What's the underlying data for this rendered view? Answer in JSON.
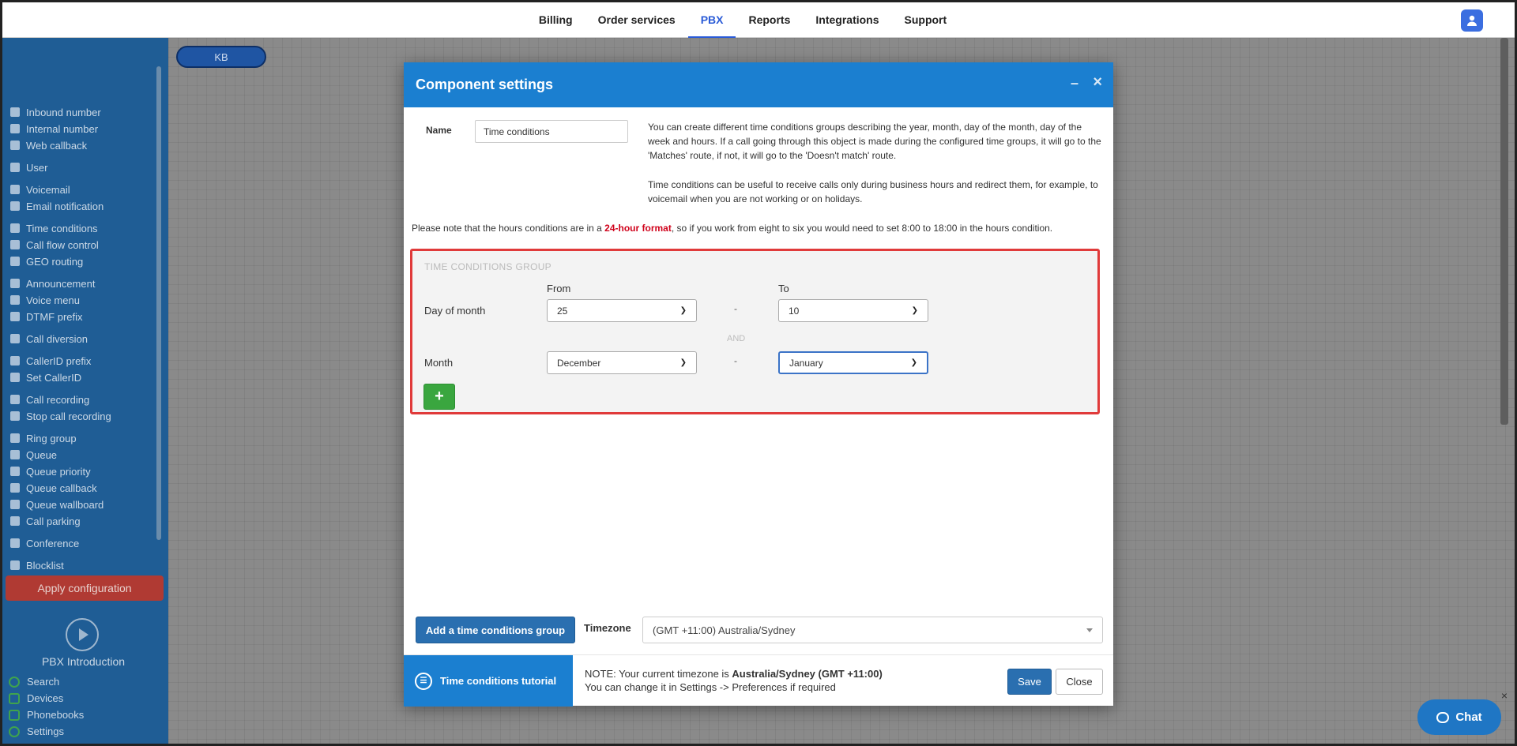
{
  "topnav": {
    "links": [
      "Billing",
      "Order services",
      "PBX",
      "Reports",
      "Integrations",
      "Support"
    ],
    "active": "PBX"
  },
  "sidebar": {
    "items": [
      "Inbound number",
      "Internal number",
      "Web callback",
      "User",
      "Voicemail",
      "Email notification",
      "Time conditions",
      "Call flow control",
      "GEO routing",
      "Announcement",
      "Voice menu",
      "DTMF prefix",
      "Call diversion",
      "CallerID prefix",
      "Set CallerID",
      "Call recording",
      "Stop call recording",
      "Ring group",
      "Queue",
      "Queue priority",
      "Queue callback",
      "Queue wallboard",
      "Call parking",
      "Conference",
      "Blocklist"
    ],
    "apply_label": "Apply configuration",
    "intro_label": "PBX Introduction",
    "bottom_links": [
      "Search",
      "Devices",
      "Phonebooks",
      "Settings"
    ]
  },
  "canvas": {
    "node_label": "KB"
  },
  "modal": {
    "title": "Component settings",
    "name_label": "Name",
    "name_value": "Time conditions",
    "desc1": "You can create different time conditions groups describing the year, month, day of the month, day of the week and hours. If a call going through this object is made during the configured time groups, it will go to the 'Matches' route, if not, it will go to the 'Doesn't match' route.",
    "desc2": "Time conditions can be useful to receive calls only during business hours and redirect them, for example, to voicemail when you are not working or on holidays.",
    "note_pre": "Please note that the hours conditions are in a ",
    "note_red": "24-hour format",
    "note_post": ", so if you work from eight to six you would need to set 8:00 to 18:00 in the hours condition.",
    "group": {
      "title": "TIME CONDITIONS GROUP",
      "from_label": "From",
      "to_label": "To",
      "dash": "-",
      "and_label": "AND",
      "rows": [
        {
          "label": "Day of month",
          "from": "25",
          "to": "10"
        },
        {
          "label": "Month",
          "from": "December",
          "to": "January"
        }
      ],
      "plus": "+"
    },
    "add_group_label": "Add a time conditions group",
    "timezone_label": "Timezone",
    "timezone_value": "(GMT +11:00) Australia/Sydney",
    "tutorial_label": "Time conditions tutorial",
    "tz_note_pre": "NOTE: Your current timezone is ",
    "tz_note_bold": "Australia/Sydney (GMT +11:00)",
    "tz_note_line2": "You can change it in Settings -> Preferences if required",
    "save_label": "Save",
    "close_label": "Close"
  },
  "chat": {
    "label": "Chat",
    "close": "×"
  },
  "colors": {
    "accent": "#1b7fd0",
    "sidebar": "#1f5d95",
    "apply": "#b03a33",
    "highlight": "#e03a3a",
    "plus": "#3aa63f"
  }
}
